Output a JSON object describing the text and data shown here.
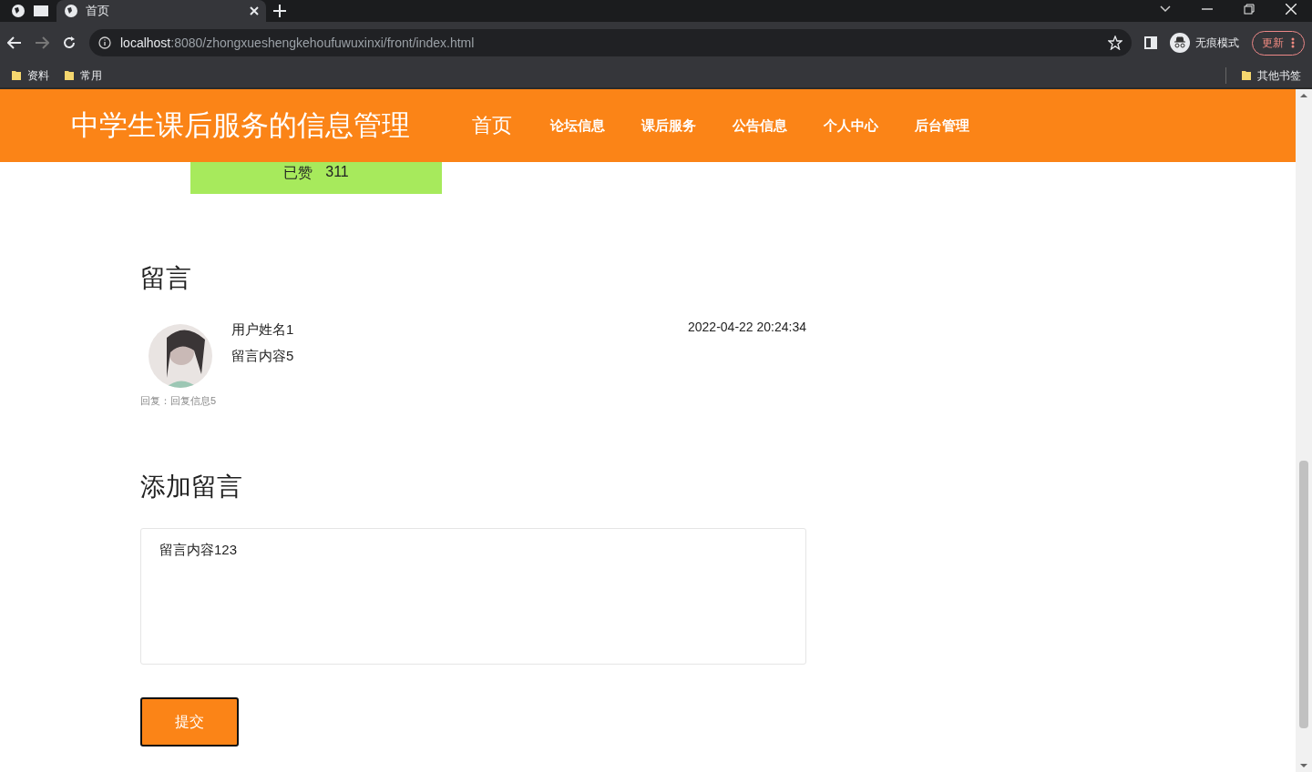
{
  "browser": {
    "tabs": [
      {
        "title": "首页",
        "selected": true
      }
    ],
    "address": {
      "host": "localhost",
      "path": ":8080/zhongxueshengkehoufuwuxinxi/front/index.html"
    },
    "profile_label": "无痕模式",
    "update_button": "更新",
    "bookmarks": [
      {
        "label": "资料"
      },
      {
        "label": "常用"
      }
    ],
    "other_bookmarks": "其他书签"
  },
  "site": {
    "title": "中学生课后服务的信息管理",
    "nav": [
      {
        "label": "首页",
        "selected": true
      },
      {
        "label": "论坛信息",
        "selected": false
      },
      {
        "label": "课后服务",
        "selected": false
      },
      {
        "label": "公告信息",
        "selected": false
      },
      {
        "label": "个人中心",
        "selected": false
      },
      {
        "label": "后台管理",
        "selected": false
      }
    ]
  },
  "like_button": {
    "label": "已赞",
    "count": "311"
  },
  "comments_heading": "留言",
  "comments": [
    {
      "user": "用户姓名1",
      "content": "留言内容5",
      "time": "2022-04-22 20:24:34",
      "reply": "回复：回复信息5"
    }
  ],
  "add_heading": "添加留言",
  "message_field": {
    "value": "留言内容123"
  },
  "submit_button": "提交"
}
